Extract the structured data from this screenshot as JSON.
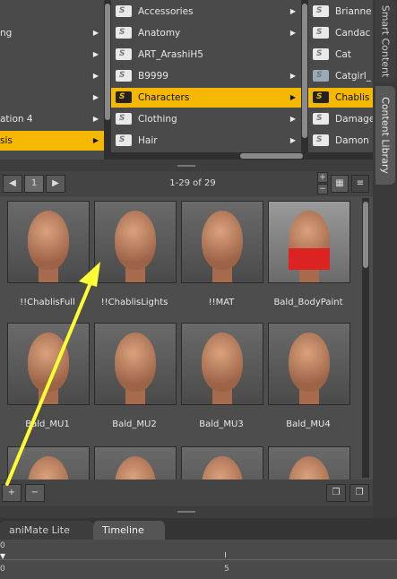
{
  "browser": {
    "col1": [
      {
        "label": "ng",
        "arrow": true,
        "sel": false
      },
      {
        "label": "",
        "arrow": true,
        "sel": false
      },
      {
        "label": "",
        "arrow": true,
        "sel": false
      },
      {
        "label": "",
        "arrow": true,
        "sel": false
      },
      {
        "label": "ation 4",
        "arrow": true,
        "sel": false
      },
      {
        "label": "sis",
        "arrow": true,
        "sel": true
      }
    ],
    "col2": [
      {
        "label": "Accessories",
        "arrow": true,
        "sel": false
      },
      {
        "label": "Anatomy",
        "arrow": true,
        "sel": false
      },
      {
        "label": "ART_ArashiH5",
        "arrow": false,
        "sel": false
      },
      {
        "label": "B9999",
        "arrow": true,
        "sel": false
      },
      {
        "label": "Characters",
        "arrow": true,
        "sel": true
      },
      {
        "label": "Clothing",
        "arrow": true,
        "sel": false
      },
      {
        "label": "Hair",
        "arrow": true,
        "sel": false
      }
    ],
    "col3": [
      {
        "label": "Brianne",
        "sel": false
      },
      {
        "label": "Candac",
        "sel": false
      },
      {
        "label": "Cat",
        "sel": false
      },
      {
        "label": "Catgirl_",
        "sel": false
      },
      {
        "label": "Chablis",
        "sel": true
      },
      {
        "label": "Damage",
        "sel": false
      },
      {
        "label": "Damon",
        "sel": false
      }
    ]
  },
  "side_tabs": {
    "smart_content": "Smart Content",
    "content_library": "Content Library"
  },
  "toolbar": {
    "page": "1",
    "count": "1-29 of 29",
    "prev_icon": "arrow-left-icon",
    "next_icon": "arrow-right-icon"
  },
  "grid": {
    "items": [
      {
        "label": "!!ChablisFull"
      },
      {
        "label": "!!ChablisLights"
      },
      {
        "label": "!!MAT"
      },
      {
        "label": "Bald_BodyPaint"
      },
      {
        "label": "Bald_MU1"
      },
      {
        "label": "Bald_MU2"
      },
      {
        "label": "Bald_MU3"
      },
      {
        "label": "Bald_MU4"
      },
      {
        "label": ""
      },
      {
        "label": ""
      },
      {
        "label": ""
      },
      {
        "label": ""
      }
    ]
  },
  "bottom_tabs": {
    "animate": "aniMate Lite",
    "timeline": "Timeline"
  },
  "timeline": {
    "frame0": "0",
    "frame0b": "0",
    "frame5": "5"
  },
  "colors": {
    "accent": "#f5b800",
    "annotation_arrow": "#ffff33"
  }
}
